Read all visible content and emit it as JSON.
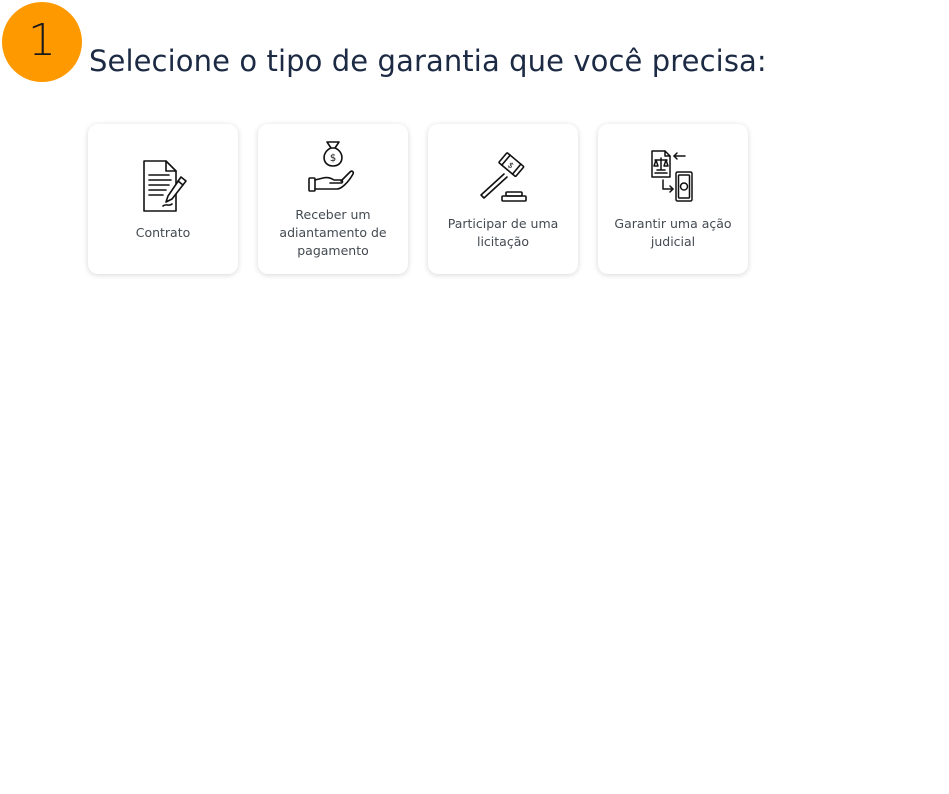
{
  "step": {
    "number": "1",
    "color": "#ff9900"
  },
  "heading": "Selecione o tipo de garantia que você precisa:",
  "options": [
    {
      "label": "Contrato",
      "icon": "contract-document-icon"
    },
    {
      "label": "Receber um adiantamento de pagamento",
      "icon": "money-bag-hand-icon"
    },
    {
      "label": "Participar de uma licitação",
      "icon": "auction-gavel-icon"
    },
    {
      "label": "Garantir uma ação judicial",
      "icon": "legal-document-money-icon"
    }
  ]
}
